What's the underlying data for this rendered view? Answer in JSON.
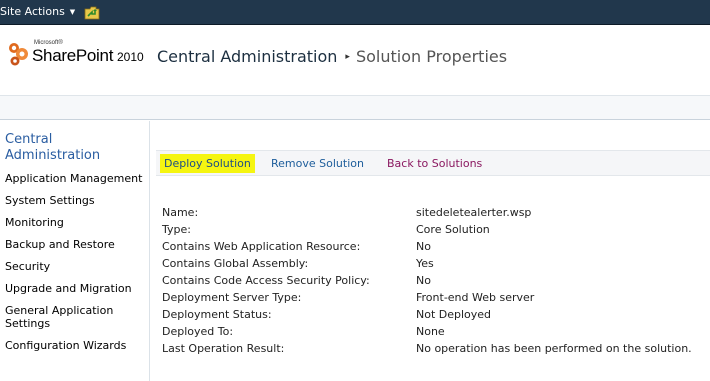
{
  "topbar": {
    "site_actions": "Site Actions",
    "caret": "▼",
    "nav_icon": "navigate-up-icon"
  },
  "title": {
    "microsoft": "Microsoft®",
    "product": "SharePoint",
    "version": "2010",
    "breadcrumb_root": "Central Administration",
    "breadcrumb_sep": "▸",
    "breadcrumb_current": "Solution Properties"
  },
  "leftnav": {
    "heading": "Central Administration",
    "items": [
      "Application Management",
      "System Settings",
      "Monitoring",
      "Backup and Restore",
      "Security",
      "Upgrade and Migration",
      "General Application Settings",
      "Configuration Wizards"
    ]
  },
  "toolbar": {
    "deploy": "Deploy Solution",
    "remove": "Remove Solution",
    "back": "Back to Solutions"
  },
  "properties": [
    {
      "label": "Name:",
      "value": "sitedeletealerter.wsp"
    },
    {
      "label": "Type:",
      "value": "Core Solution"
    },
    {
      "label": "Contains Web Application Resource:",
      "value": "No"
    },
    {
      "label": "Contains Global Assembly:",
      "value": "Yes"
    },
    {
      "label": "Contains Code Access Security Policy:",
      "value": "No"
    },
    {
      "label": "Deployment Server Type:",
      "value": "Front-end Web server"
    },
    {
      "label": "Deployment Status:",
      "value": "Not Deployed"
    },
    {
      "label": "Deployed To:",
      "value": "None"
    },
    {
      "label": "Last Operation Result:",
      "value": "No operation has been performed on the solution."
    }
  ],
  "colors": {
    "topbar": "#21374c",
    "highlight": "#f5f511",
    "link": "#1d5d9b",
    "back_link": "#8a1860",
    "nav_heading": "#2a5da1"
  }
}
